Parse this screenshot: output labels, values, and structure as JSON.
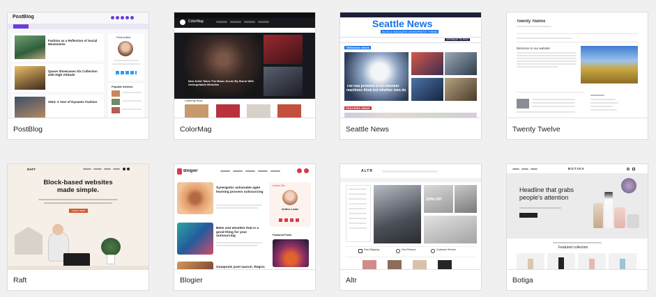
{
  "themes": [
    {
      "name": "PostBlog"
    },
    {
      "name": "ColorMag"
    },
    {
      "name": "Seattle News"
    },
    {
      "name": "Twenty Twelve"
    },
    {
      "name": "Raft"
    },
    {
      "name": "Blogier"
    },
    {
      "name": "Altr"
    },
    {
      "name": "Botiga"
    }
  ],
  "previews": {
    "postblog": {
      "logo": "PostBlog",
      "headline1": "Fashion as a Reflection of Social Movements",
      "headline2": "Queue Showcases Six Collection with High Attitude",
      "headline3": "2024: A Year of Dynamic Fashion",
      "author": "Post Author",
      "popular": "Popular Articles"
    },
    "colormag": {
      "logo": "ColorMag",
      "headline": "New Artist Takes The Music Scene By Storm With Unforgettable Melodies",
      "section": "Celebrity Buzz"
    },
    "seattle": {
      "title": "Seattle News",
      "subtitle": "BLOG & MAGAZINE WORDPRESS THEME",
      "trending": "TRENDING NEWS",
      "headline": "The real problem is not whether machines think but whether men do",
      "featured": "FEATURED NEWS",
      "cta": "UPGRADE TO PRO"
    },
    "twelve": {
      "title": "Twenty Twelve",
      "welcome": "Welcome to our website"
    },
    "raft": {
      "logo": "RAFT",
      "headline": "Block-based websites made simple.",
      "button": "Learn more"
    },
    "blogier": {
      "logo": "Blogier",
      "headline1": "Synergistic actionable agile learning process outsourcing",
      "headline2": "Bells and whistles that is a good thing for your outsourcing",
      "headline3": "Goalposts post launch. Regroup",
      "author_title": "Author Bio",
      "author": "Arthur Lewis",
      "featured": "Featured Posts"
    },
    "altr": {
      "logo": "ALTR",
      "stat": "20% Off",
      "feature1": "Free Shipping",
      "feature2": "Free Returns",
      "feature3": "Customer Service"
    },
    "botiga": {
      "logo": "BOTIGA",
      "headline": "Headline that grabs people's attention",
      "collection": "Featured collection"
    }
  },
  "colors": {
    "page_bg": "#f0f0f1",
    "postblog_accent": "#6b3fd4",
    "colormag_dark": "#16181d",
    "seattle_blue": "#1a73e8",
    "seattle_red": "#d32f2f",
    "raft_bg": "#f6efe7",
    "raft_orange": "#d4572f",
    "blogier_red": "#d7394b",
    "botiga_bg": "#ebebeb"
  }
}
